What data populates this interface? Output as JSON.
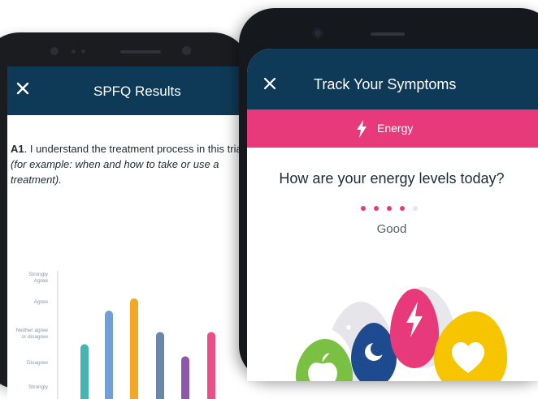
{
  "back_screen": {
    "title": "SPFQ Results",
    "question_id": "A1",
    "question_text": ". I understand the treatment process in this trial ",
    "question_example": "(for example: when and how to take or use a treatment).",
    "chart_data": {
      "type": "bar",
      "ylabels": [
        "Strongly Agree",
        "Agree",
        "Neither agree or disagree",
        "Disagree",
        "Strongly"
      ],
      "series": [
        {
          "color": "#43b5b3",
          "value": 2.8
        },
        {
          "color": "#6f9fd6",
          "value": 3.9
        },
        {
          "color": "#f5a623",
          "value": 4.3
        },
        {
          "color": "#6b86a8",
          "value": 3.2
        },
        {
          "color": "#8e58a8",
          "value": 2.4
        },
        {
          "color": "#e84f8a",
          "value": 3.2
        }
      ]
    }
  },
  "front_screen": {
    "title": "Track Your Symptoms",
    "category_label": "Energy",
    "question": "How are your energy levels today?",
    "level": 4,
    "level_max": 5,
    "level_text": "Good",
    "colors": {
      "header": "#0f3a57",
      "accent": "#e8397a"
    }
  }
}
